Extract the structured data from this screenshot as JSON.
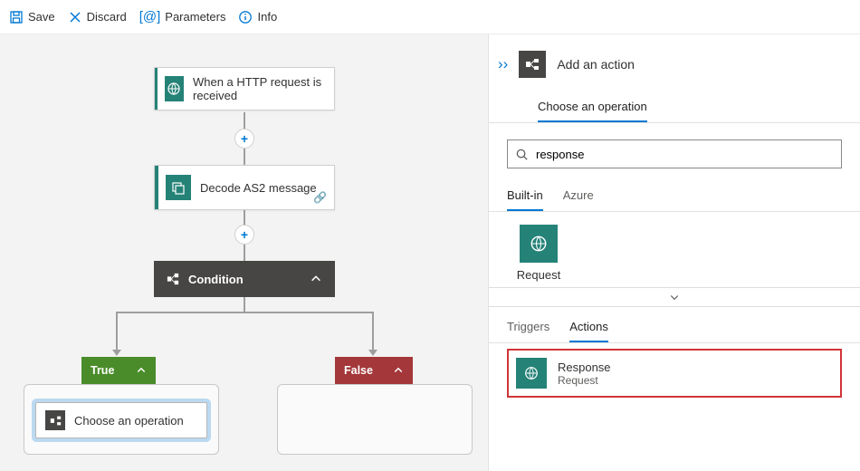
{
  "toolbar": {
    "save": "Save",
    "discard": "Discard",
    "parameters": "Parameters",
    "info": "Info"
  },
  "canvas": {
    "trigger_label": "When a HTTP request is received",
    "decode_label": "Decode AS2 message",
    "condition_label": "Condition",
    "true_label": "True",
    "false_label": "False",
    "choose_op_label": "Choose an operation"
  },
  "panel": {
    "header": "Add an action",
    "tab_choose": "Choose an operation",
    "search_value": "response",
    "tab_builtin": "Built-in",
    "tab_azure": "Azure",
    "connector_request": "Request",
    "subtab_triggers": "Triggers",
    "subtab_actions": "Actions",
    "result_title": "Response",
    "result_sub": "Request"
  },
  "colors": {
    "teal": "#258277",
    "blue": "#0078d4",
    "dark": "#484644",
    "green": "#4a8c2a",
    "red": "#a4373a",
    "highlight": "#d13438"
  }
}
